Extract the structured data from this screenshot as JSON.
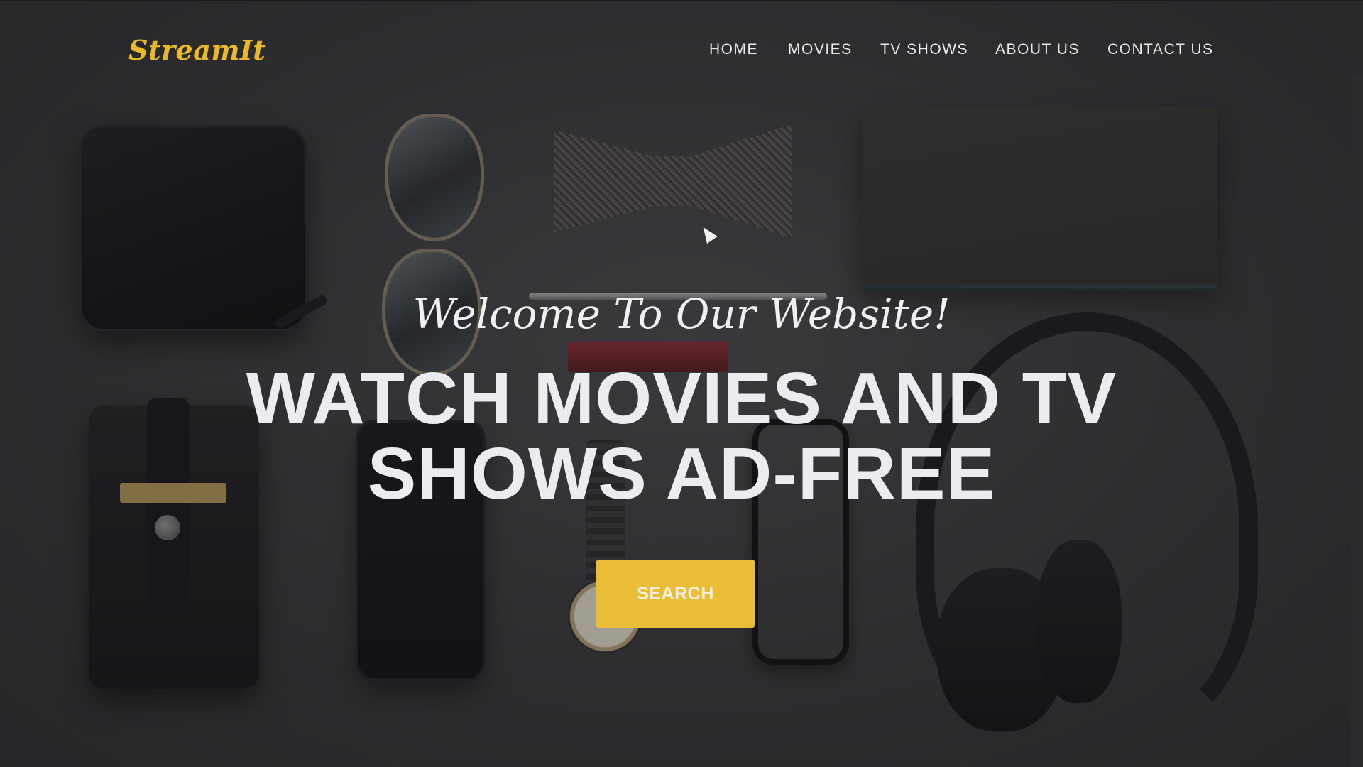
{
  "header": {
    "logo_text": "StreamIt",
    "nav": [
      {
        "label": "HOME"
      },
      {
        "label": "MOVIES"
      },
      {
        "label": "TV SHOWS"
      },
      {
        "label": "ABOUT US"
      },
      {
        "label": "CONTACT US"
      }
    ]
  },
  "hero": {
    "welcome": "Welcome To Our Website!",
    "title_line1": "WATCH MOVIES AND TV",
    "title_line2": "SHOWS AD-FREE",
    "search_label": "SEARCH"
  },
  "colors": {
    "accent": "#e9bd35",
    "text": "#ececf0",
    "overlay": "#2a2a2c"
  },
  "icons": {
    "cursor": "mouse-pointer-icon"
  }
}
